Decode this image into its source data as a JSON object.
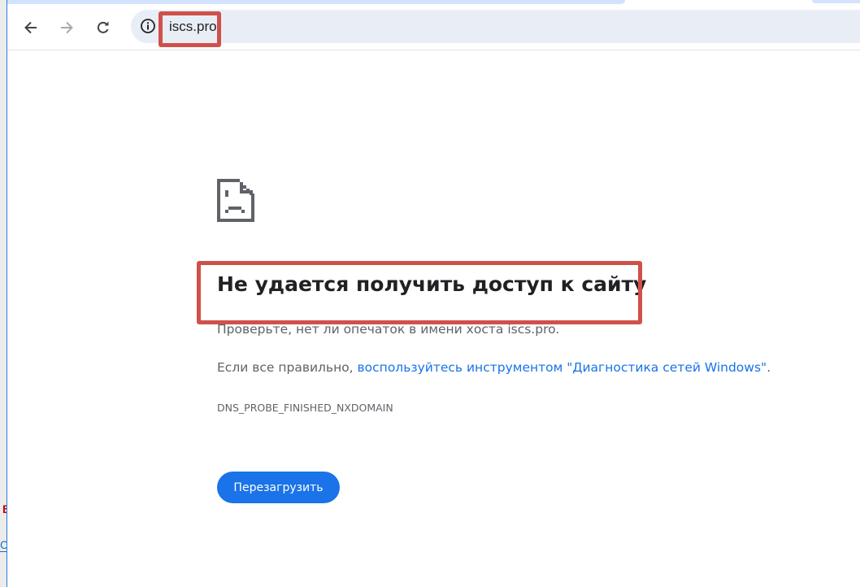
{
  "browser": {
    "url": "iscs.pro",
    "back_icon": "arrow-left-icon",
    "forward_icon": "arrow-right-icon",
    "reload_icon": "reload-icon",
    "site_info_icon": "info-icon"
  },
  "error": {
    "icon": "sad-page-icon",
    "title": "Не удается получить доступ к сайту",
    "line1": "Проверьте, нет ли опечаток в имени хоста iscs.pro.",
    "line2_prefix": "Если все правильно, ",
    "line2_link": "воспользуйтесь инструментом \"Диагностика сетей Windows\"",
    "line2_suffix": ".",
    "code": "DNS_PROBE_FINISHED_NXDOMAIN",
    "reload_button": "Перезагрузить"
  },
  "background_window": {
    "letter_b": "Б",
    "letter_c": "С"
  },
  "colors": {
    "accent": "#1a73e8",
    "highlight": "#d0504a"
  }
}
